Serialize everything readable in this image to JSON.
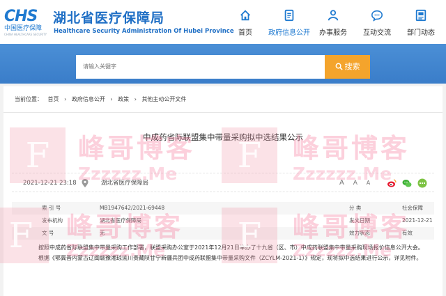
{
  "header": {
    "logo_mark": "CHS",
    "logo_sub": "中国医疗保障",
    "logo_tiny": "CHINA HEALTHCARE SECURITY",
    "title": "湖北省医疗保障局",
    "subtitle": "Healthcare Security Administration Of Hubei Province",
    "nav": [
      {
        "label": "首页",
        "icon": "home-icon"
      },
      {
        "label": "政府信息公开",
        "icon": "document-icon",
        "active": true
      },
      {
        "label": "办事服务",
        "icon": "person-icon"
      },
      {
        "label": "互动交流",
        "icon": "chat-icon"
      },
      {
        "label": "部门动态",
        "icon": "news-icon"
      }
    ]
  },
  "search": {
    "placeholder": "请输入关键字",
    "button_label": "搜索"
  },
  "breadcrumb": {
    "prefix": "当前位置：",
    "items": [
      "首页",
      "政府信息公开",
      "政策",
      "其他主动公开文件"
    ],
    "separator": "›"
  },
  "article": {
    "title": "中成药省际联盟集中带量采购拟中选结果公示",
    "date": "2021-12-21 23:18",
    "source": "湖北省医疗保障局",
    "font_sizes": [
      "A",
      "A",
      "A"
    ],
    "info": {
      "index_label": "索  引  号",
      "index_value": "MB1947642/2021-69448",
      "category_label": "分    类",
      "category_value": "社会保障",
      "issuer_label": "发布机构",
      "issuer_value": "湖北省医疗保障局",
      "date_label": "发文日期",
      "date_value": "2021-12-21",
      "docno_label": "文    号",
      "docno_value": "无",
      "validity_label": "效力状态",
      "validity_value": "有效"
    },
    "body": "按照中成药省际联盟集中带量采购工作部署，联盟采购办公室于2021年12月21日举办了十九省（区、市）中成药联盟集中带量采购现场报价信息公开大会。根据《鄂冀晋内蒙古辽闽赣豫湘琼渝川贵藏陕甘宁新疆兵团中成药联盟集中带量采购文件（ZCYLM-2021-1）》规定，现将拟中选结果进行公示，详见附件。"
  },
  "watermark": {
    "letter": "F",
    "cn": "峰哥博客",
    "en": "Zzzzzz.Me"
  },
  "colors": {
    "brand_blue": "#1f7ad0",
    "search_band": "#3a7dc9",
    "search_button": "#f4a42c"
  }
}
